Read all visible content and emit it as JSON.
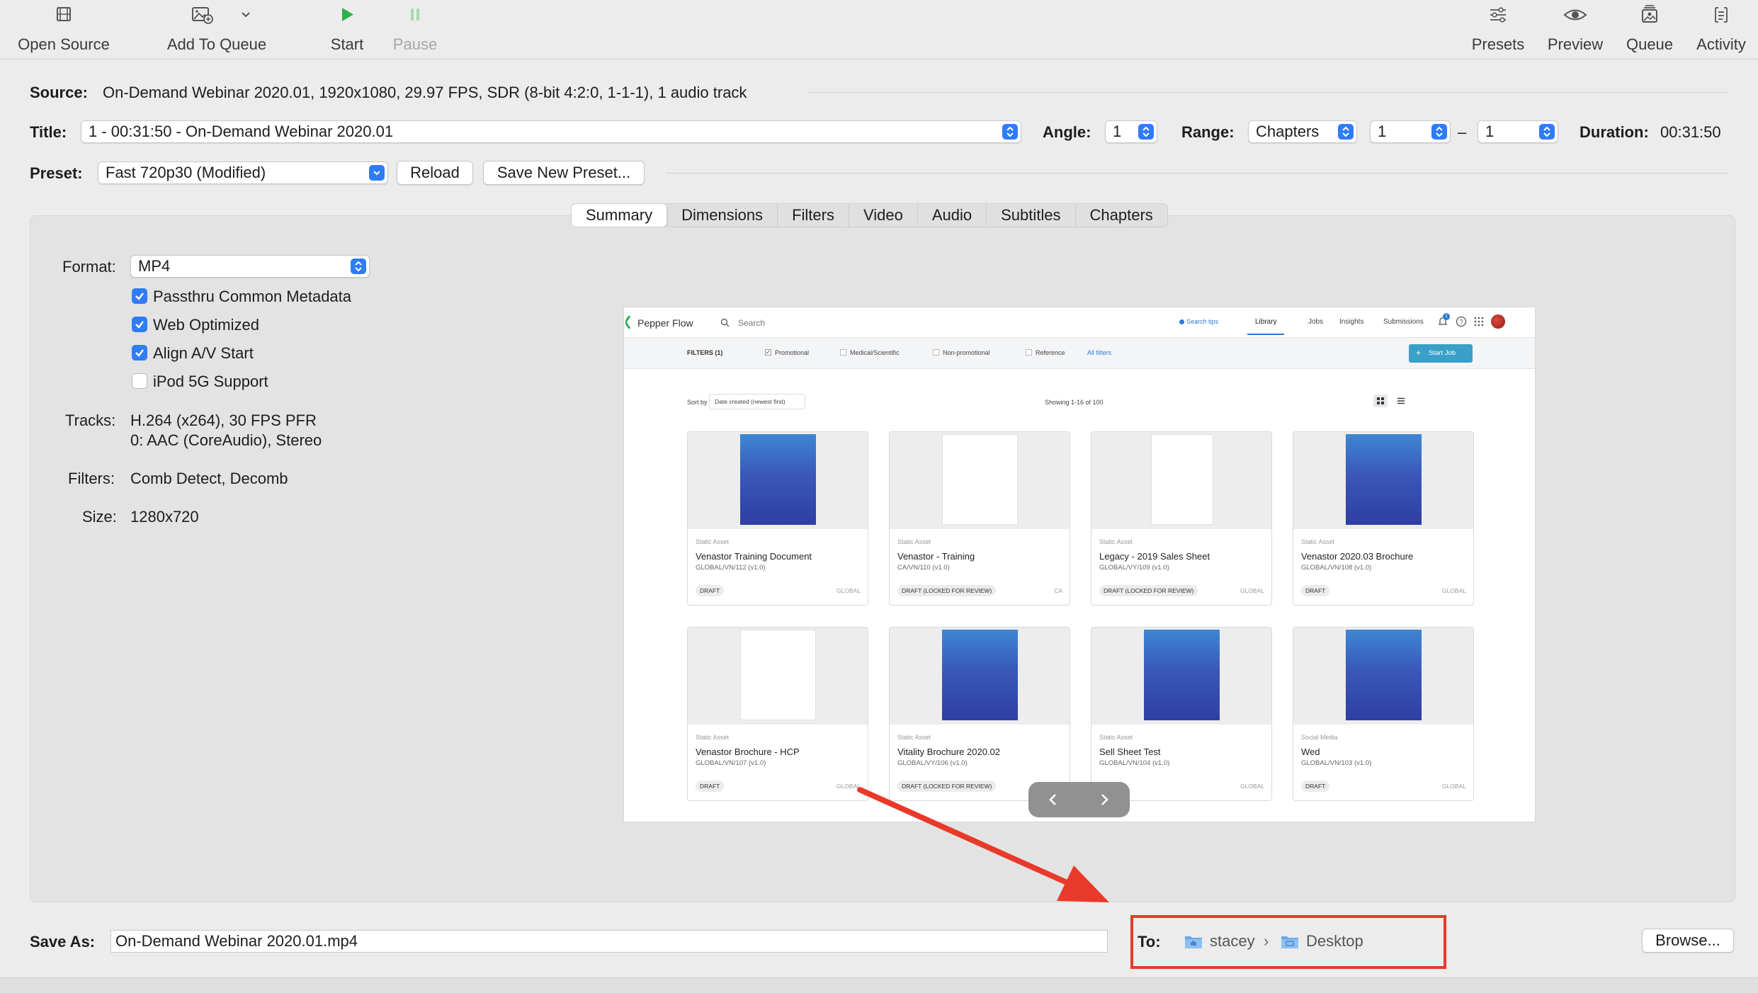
{
  "toolbar": {
    "open_source": "Open Source",
    "add_to_queue": "Add To Queue",
    "start": "Start",
    "pause": "Pause",
    "presets": "Presets",
    "preview": "Preview",
    "queue": "Queue",
    "activity": "Activity"
  },
  "source": {
    "label": "Source:",
    "value": "On-Demand Webinar 2020.01, 1920x1080, 29.97 FPS, SDR (8-bit 4:2:0, 1-1-1), 1 audio track"
  },
  "title_row": {
    "title_label": "Title:",
    "title_value": "1 - 00:31:50 - On-Demand Webinar 2020.01",
    "angle_label": "Angle:",
    "angle_value": "1",
    "range_label": "Range:",
    "range_type": "Chapters",
    "range_start": "1",
    "range_dash": "–",
    "range_end": "1",
    "duration_label": "Duration:",
    "duration_value": "00:31:50"
  },
  "preset_row": {
    "label": "Preset:",
    "value": "Fast 720p30 (Modified)",
    "reload": "Reload",
    "save_new": "Save New Preset..."
  },
  "tabs": [
    "Summary",
    "Dimensions",
    "Filters",
    "Video",
    "Audio",
    "Subtitles",
    "Chapters"
  ],
  "summary": {
    "format_label": "Format:",
    "format_value": "MP4",
    "options": [
      {
        "label": "Passthru Common Metadata",
        "checked": true
      },
      {
        "label": "Web Optimized",
        "checked": true
      },
      {
        "label": "Align A/V Start",
        "checked": true
      },
      {
        "label": "iPod 5G Support",
        "checked": false
      }
    ],
    "tracks_label": "Tracks:",
    "tracks_line1": "H.264 (x264), 30 FPS PFR",
    "tracks_line2": "0: AAC (CoreAudio), Stereo",
    "filters_label": "Filters:",
    "filters_value": "Comb Detect, Decomb",
    "size_label": "Size:",
    "size_value": "1280x720"
  },
  "preview_frame": {
    "brand": "Pepper Flow",
    "search_placeholder": "Search",
    "search_tips": "Search tips",
    "nav": [
      "Library",
      "Jobs",
      "Insights",
      "Submissions"
    ],
    "notification_count": "1",
    "filters_label": "FILTERS (1)",
    "filter_options": [
      {
        "label": "Promotional",
        "checked": true
      },
      {
        "label": "Medical/Scientific",
        "checked": false
      },
      {
        "label": "Non-promotional",
        "checked": false
      },
      {
        "label": "Reference",
        "checked": false
      }
    ],
    "all_filters": "All filters",
    "start_job": "Start Job",
    "sort_by": "Sort by",
    "sort_value": "Date created (newest first)",
    "showing": "Showing 1-16 of 100",
    "cards": [
      {
        "type": "Static Asset",
        "title": "Venastor Training Document",
        "id": "GLOBAL/VN/112 (v1.0)",
        "badge": "DRAFT",
        "region": "GLOBAL",
        "thumb": "brochure"
      },
      {
        "type": "Static Asset",
        "title": "Venastor - Training",
        "id": "CA/VN/110 (v1.0)",
        "badge": "DRAFT (LOCKED FOR REVIEW)",
        "region": "CA",
        "thumb": "doc"
      },
      {
        "type": "Static Asset",
        "title": "Legacy - 2019 Sales Sheet",
        "id": "GLOBAL/VY/109 (v1.0)",
        "badge": "DRAFT (LOCKED FOR REVIEW)",
        "region": "GLOBAL",
        "thumb": "list"
      },
      {
        "type": "Static Asset",
        "title": "Venastor 2020.03 Brochure",
        "id": "GLOBAL/VN/108 (v1.0)",
        "badge": "DRAFT",
        "region": "GLOBAL",
        "thumb": "brochure"
      },
      {
        "type": "Static Asset",
        "title": "Venastor Brochure - HCP",
        "id": "GLOBAL/VN/107 (v1.0)",
        "badge": "DRAFT",
        "region": "GLOBAL",
        "thumb": "doc"
      },
      {
        "type": "Static Asset",
        "title": "Vitality Brochure 2020.02",
        "id": "GLOBAL/VY/106 (v1.0)",
        "badge": "DRAFT (LOCKED FOR REVIEW)",
        "region": "",
        "thumb": "brochure"
      },
      {
        "type": "Static Asset",
        "title": "Sell Sheet Test",
        "id": "GLOBAL/VN/104 (v1.0)",
        "badge": "",
        "region": "GLOBAL",
        "thumb": "brochure"
      },
      {
        "type": "Social Media",
        "title": "Wed",
        "id": "GLOBAL/VN/103 (v1.0)",
        "badge": "DRAFT",
        "region": "GLOBAL",
        "thumb": "brochure"
      }
    ]
  },
  "save": {
    "label": "Save As:",
    "filename": "On-Demand Webinar 2020.01.mp4",
    "to_label": "To:",
    "path": [
      "stacey",
      "Desktop"
    ],
    "path_sep": "›",
    "browse": "Browse..."
  },
  "colors": {
    "accent": "#2f7cf6",
    "start_green": "#2bb24c",
    "annotation_red": "#e8392a",
    "window_bg": "#ececec",
    "panel_bg": "#e3e3e3"
  }
}
